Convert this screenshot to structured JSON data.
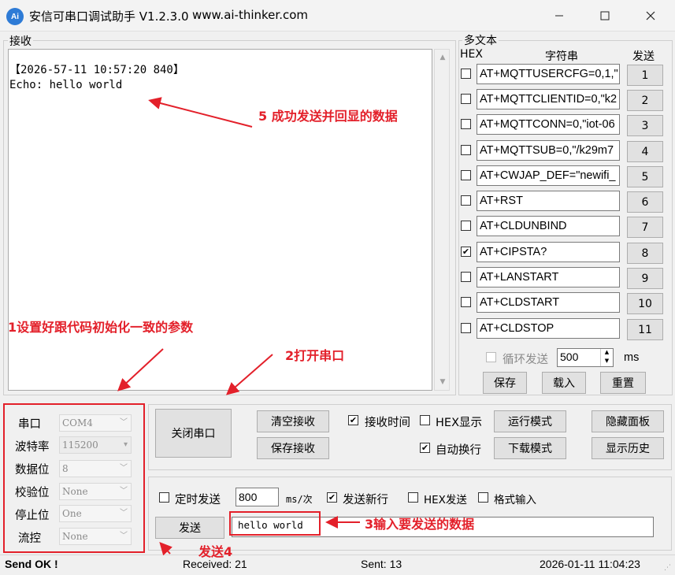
{
  "window": {
    "app_icon": "Ai",
    "title": "安信可串口调试助手 V1.2.3.0",
    "url": "www.ai-thinker.com",
    "minimize_icon": "minimize-icon",
    "maximize_icon": "maximize-icon",
    "close_icon": "close-icon"
  },
  "receive": {
    "group_label": "接收",
    "lines": [
      "【2026-57-11 10:57:20 840】",
      "Echo: hello world"
    ]
  },
  "multi": {
    "group_label": "多文本",
    "hex_header": "HEX",
    "string_header": "字符串",
    "send_header": "发送",
    "rows": [
      {
        "checked": false,
        "text": "AT+MQTTUSERCFG=0,1,\"",
        "button": "1"
      },
      {
        "checked": false,
        "text": "AT+MQTTCLIENTID=0,\"k2",
        "button": "2"
      },
      {
        "checked": false,
        "text": "AT+MQTTCONN=0,\"iot-06",
        "button": "3"
      },
      {
        "checked": false,
        "text": "AT+MQTTSUB=0,\"/k29m7",
        "button": "4"
      },
      {
        "checked": false,
        "text": "AT+CWJAP_DEF=\"newifi_",
        "button": "5"
      },
      {
        "checked": false,
        "text": "AT+RST",
        "button": "6"
      },
      {
        "checked": false,
        "text": "AT+CLDUNBIND",
        "button": "7"
      },
      {
        "checked": true,
        "text": "AT+CIPSTA?",
        "button": "8"
      },
      {
        "checked": false,
        "text": "AT+LANSTART",
        "button": "9"
      },
      {
        "checked": false,
        "text": "AT+CLDSTART",
        "button": "10"
      },
      {
        "checked": false,
        "text": "AT+CLDSTOP",
        "button": "11"
      }
    ],
    "loop_label": "循环发送",
    "loop_interval": "500",
    "loop_unit": "ms",
    "save_label": "保存",
    "load_label": "载入",
    "reset_label": "重置"
  },
  "port": {
    "port_label": "串口",
    "port_value": "COM4",
    "baud_label": "波特率",
    "baud_value": "115200",
    "data_label": "数据位",
    "data_value": "8",
    "parity_label": "校验位",
    "parity_value": "None",
    "stop_label": "停止位",
    "stop_value": "One",
    "flow_label": "流控",
    "flow_value": "None"
  },
  "controls": {
    "close_port": "关闭串口",
    "clear_receive": "清空接收",
    "save_receive": "保存接收",
    "receive_time": "接收时间",
    "receive_time_checked": true,
    "hex_display": "HEX显示",
    "hex_display_checked": false,
    "auto_newline": "自动换行",
    "auto_newline_checked": true,
    "run_mode": "运行模式",
    "download_mode": "下载模式",
    "hide_panel": "隐藏面板",
    "show_history": "显示历史"
  },
  "send": {
    "timed_send": "定时发送",
    "timed_checked": false,
    "interval": "800",
    "interval_unit": "ms/次",
    "send_newline": "发送新行",
    "send_newline_checked": true,
    "hex_send": "HEX发送",
    "hex_send_checked": false,
    "format_input": "格式输入",
    "format_input_checked": false,
    "send_button": "发送",
    "input_value": "hello world"
  },
  "status": {
    "result": "Send OK !",
    "received": "Received: 21",
    "sent": "Sent: 13",
    "datetime": "2026-01-11 11:04:23"
  },
  "annotations": {
    "a1": "1设置好跟代码初始化一致的参数",
    "a2": "2打开串口",
    "a3": "3输入要发送的数据",
    "a4": "发送4",
    "a5": "5 成功发送并回显的数据"
  },
  "colors": {
    "annotation_red": "#e3202a",
    "app_icon_blue": "#2e7bd6"
  }
}
